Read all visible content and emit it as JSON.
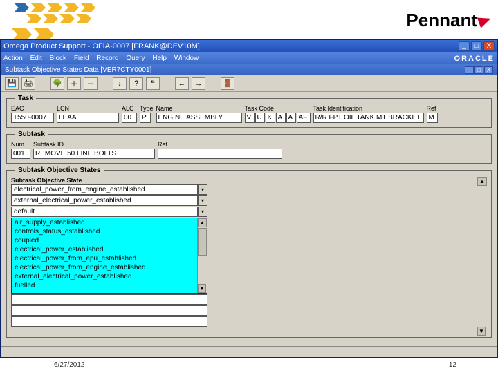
{
  "banner": {
    "brand": "Pennant"
  },
  "window": {
    "title": "Omega Product Support - OFIA-0007 [FRANK@DEV10M]",
    "menus": [
      "Action",
      "Edit",
      "Block",
      "Field",
      "Record",
      "Query",
      "Help",
      "Window"
    ],
    "oracle": "ORACLE",
    "subtitle": "Subtask Objective States Data  [VER7CTY0001]",
    "win_min": "_",
    "win_max": "□",
    "win_close": "X",
    "sub_min": "_",
    "sub_max": "□",
    "sub_close": "X"
  },
  "toolbar": {
    "save": "💾",
    "print": "🖨",
    "tree": "🌳",
    "plus": "＋",
    "minus": "－",
    "down": "↓",
    "q": "?",
    "quote": "❝",
    "left": "←",
    "right": "→",
    "exit": "🚪"
  },
  "task": {
    "legend": "Task",
    "eac_label": "EAC",
    "eac_val": "T550-0007",
    "lcn_label": "LCN",
    "lcn_val": "LEAA",
    "alc_label": "ALC",
    "alc_val": "00",
    "type_label": "Type",
    "type_val": "P",
    "name_label": "Name",
    "name_val": "ENGINE ASSEMBLY",
    "taskcode_label": "Task Code",
    "tc1": "V",
    "tc2": "U",
    "tc3": "K",
    "tc4": "A",
    "tc5": "A",
    "tc6": "AF",
    "taskid_label": "Task Identification",
    "taskid_val": "R/R FPT OIL TANK MT BRACKET ASSY",
    "ref_label": "Ref",
    "ref_val": "M"
  },
  "subtask": {
    "legend": "Subtask",
    "num_label": "Num",
    "num_val": "001",
    "sid_label": "Subtask ID",
    "sid_val": "REMOVE 50 LINE BOLTS",
    "ref_label": "Ref",
    "ref_val": ""
  },
  "sos": {
    "legend": "Subtask Objective States",
    "state_label": "Subtask Objective State",
    "rows": [
      "electrical_power_from_engine_established",
      "external_electrical_power_established",
      "default"
    ],
    "list": [
      "air_supply_established",
      "controls_status_established",
      "coupled",
      "electrical_power_established",
      "electrical_power_from_apu_established",
      "electrical_power_from_engine_established",
      "external_electrical_power_established",
      "fuelled"
    ],
    "drop": "▾",
    "up": "▲",
    "down": "▼"
  },
  "footer": {
    "date": "6/27/2012",
    "page": "12"
  }
}
